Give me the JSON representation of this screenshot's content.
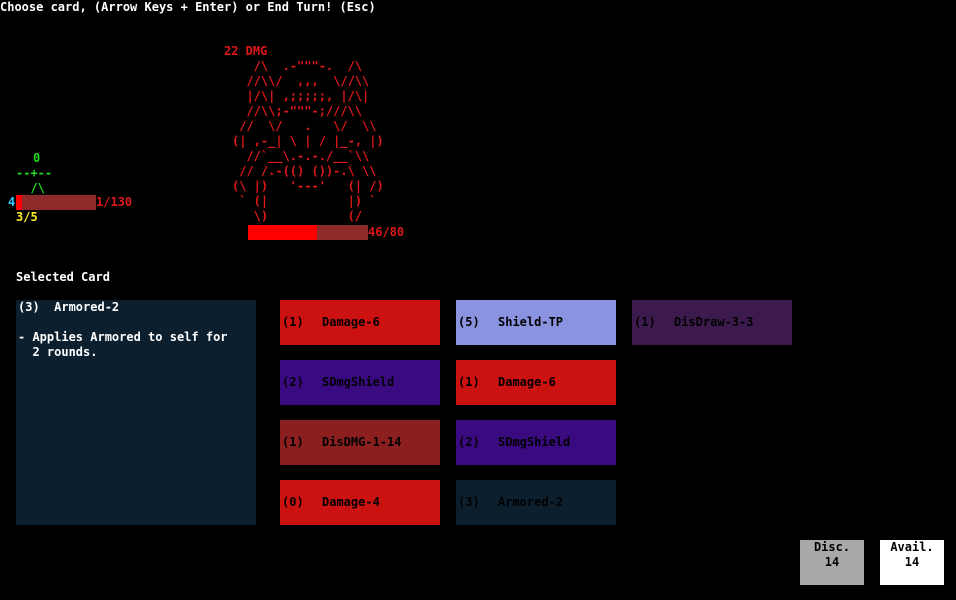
{
  "prompt": "Choose card, (Arrow Keys + Enter) or End Turn! (Esc)",
  "enemy": {
    "damage_label": "22 DMG",
    "art": "   /\\  .-\"\"\"-.  /\\\n  //\\\\/  ,,,  \\//\\\\\n  |/\\| ,;;;;;, |/\\|\n  //\\\\;-\"\"\"-;///\\\\\n //  \\/   .   \\/  \\\\\n(| ,-_| \\ | / |_-, |)\n  //`__\\.-.-./__`\\\\\n // /.-(() ())-.\\ \\\\\n(\\ |)   '---'   (| /)\n ` (|           |) `\n   \\)           (/",
    "hp_current": 46,
    "hp_max": 80,
    "hp_text": "46/80"
  },
  "player": {
    "counter": "0",
    "art": "--+--\n  /\\",
    "shield": "4",
    "hp_current": 1,
    "hp_max": 130,
    "hp_text": "1/130",
    "energy": "3/5"
  },
  "selected": {
    "heading": "Selected Card",
    "title": "(3)  Armored-2",
    "description": "- Applies Armored to self for\n  2 rounds."
  },
  "cards": [
    {
      "cost": "(1)",
      "name": "Damage-6",
      "color": "#cc1111"
    },
    {
      "cost": "(5)",
      "name": "Shield-TP",
      "color": "#8a93e0"
    },
    {
      "cost": "(1)",
      "name": "DisDraw-3-3",
      "color": "#3d1a4d"
    },
    {
      "cost": "(2)",
      "name": "SDmgShield",
      "color": "#3a0a80"
    },
    {
      "cost": "(1)",
      "name": "Damage-6",
      "color": "#cc1111"
    },
    {
      "cost": "(1)",
      "name": "DisDMG-1-14",
      "color": "#8b1f1f"
    },
    {
      "cost": "(2)",
      "name": "SDmgShield",
      "color": "#3a0a80"
    },
    {
      "cost": "(0)",
      "name": "Damage-4",
      "color": "#cc1111"
    },
    {
      "cost": "(3)",
      "name": "Armored-2",
      "color": "#0b1f2e"
    }
  ],
  "piles": {
    "discard_label": "Disc.",
    "discard_count": "14",
    "available_label": "Avail.",
    "available_count": "14"
  }
}
